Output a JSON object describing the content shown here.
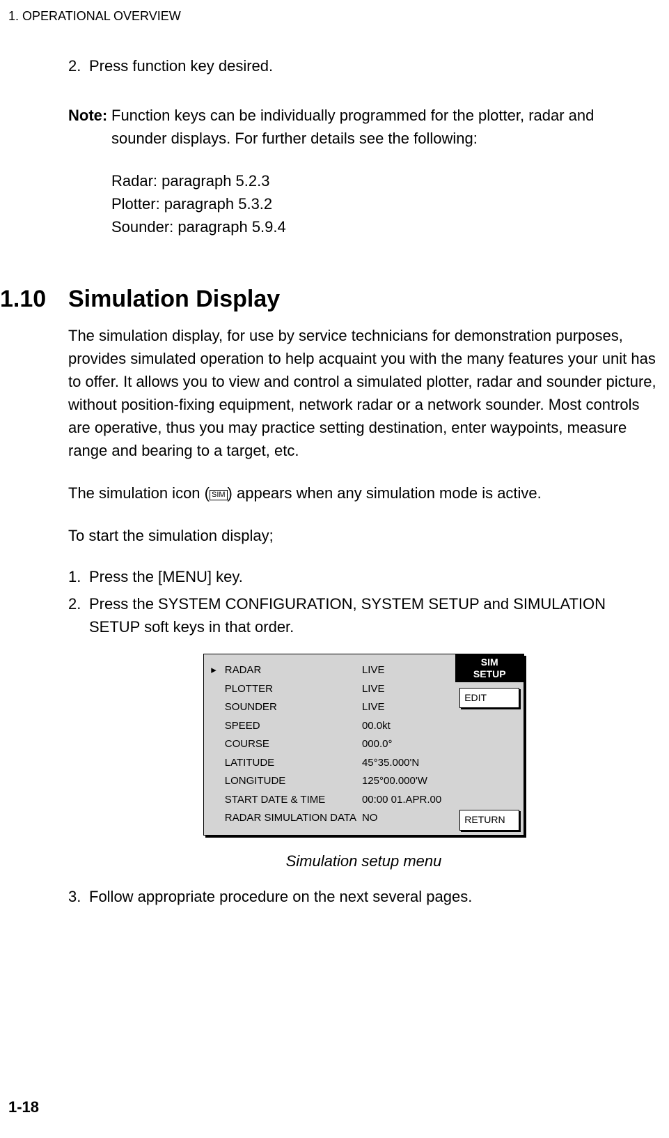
{
  "header": "1. OPERATIONAL OVERVIEW",
  "page_number": "1-18",
  "first_step": {
    "num": "2.",
    "text": "Press function key desired."
  },
  "note": {
    "label": "Note:",
    "line1": "Function keys can be individually programmed for the plotter, radar and",
    "line2": "sounder displays. For further details see the following:",
    "refs": {
      "r1": "Radar: paragraph 5.2.3",
      "r2": "Plotter: paragraph 5.3.2",
      "r3": "Sounder: paragraph 5.9.4"
    }
  },
  "section": {
    "num": "1.10",
    "title": "Simulation Display",
    "p1": "The simulation display, for use by service technicians for demonstration purposes, provides simulated operation to help acquaint you with the many features your unit has to offer. It allows you to view and control a simulated plotter, radar and sounder picture, without position-fixing equipment, network radar or a network sounder. Most controls are operative, thus you may practice setting destination, enter waypoints, measure range and bearing to a target, etc.",
    "p2a": "The simulation icon (",
    "icon": "SIM",
    "p2b": ") appears when any simulation mode is active.",
    "p3": "To start the simulation display;",
    "steps": {
      "s1n": "1.",
      "s1": "Press the [MENU] key.",
      "s2n": "2.",
      "s2": "Press the SYSTEM CONFIGURATION, SYSTEM SETUP and SIMULATION SETUP soft keys in that order."
    },
    "caption": "Simulation setup menu",
    "s3n": "3.",
    "s3": "Follow appropriate procedure on the next several pages."
  },
  "menu": {
    "title1": "SIM",
    "title2": "SETUP",
    "softkey_edit": "EDIT",
    "softkey_return": "RETURN",
    "pointer": "▸",
    "rows": [
      {
        "label": "RADAR",
        "value": "LIVE"
      },
      {
        "label": "PLOTTER",
        "value": "LIVE"
      },
      {
        "label": "SOUNDER",
        "value": "LIVE"
      },
      {
        "label": "SPEED",
        "value": "00.0kt"
      },
      {
        "label": "COURSE",
        "value": "000.0°"
      },
      {
        "label": "LATITUDE",
        "value": "45°35.000'N"
      },
      {
        "label": "LONGITUDE",
        "value": "125°00.000'W"
      },
      {
        "label": "START DATE & TIME",
        "value": "00:00 01.APR.00"
      },
      {
        "label": "RADAR SIMULATION DATA",
        "value": "NO"
      }
    ]
  }
}
